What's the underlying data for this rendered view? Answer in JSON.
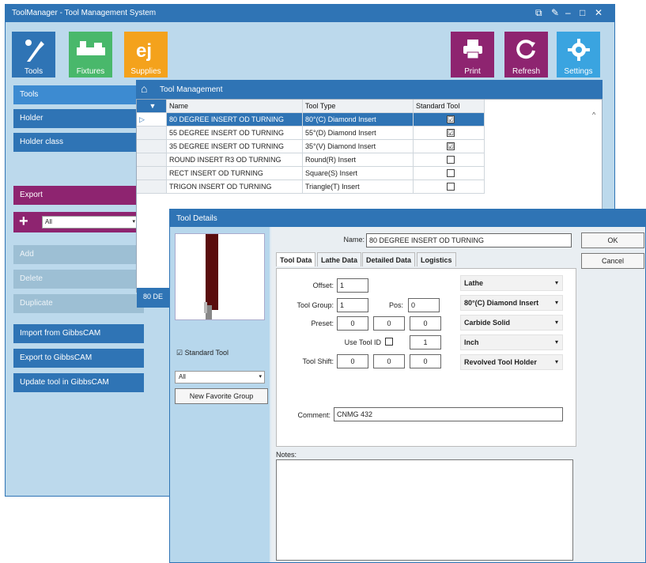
{
  "main_window": {
    "title": "ToolManager - Tool Management System",
    "ribbon_left": [
      {
        "label": "Tools",
        "icon": "tools-icon",
        "color": "#2f74b5"
      },
      {
        "label": "Fixtures",
        "icon": "fixtures-icon",
        "color": "#49b86b"
      },
      {
        "label": "Supplies",
        "icon": "supplies-icon",
        "color": "#f4a21c"
      }
    ],
    "ribbon_right": [
      {
        "label": "Print",
        "icon": "printer-icon",
        "color": "#8e2470"
      },
      {
        "label": "Refresh",
        "icon": "refresh-icon",
        "color": "#8e2470"
      },
      {
        "label": "Settings",
        "icon": "gear-icon",
        "color": "#3aa4e0"
      }
    ]
  },
  "sidebar": {
    "tools": "Tools",
    "holder": "Holder",
    "holder_class": "Holder class",
    "export": "Export",
    "filter_value": "All",
    "add": "Add",
    "delete": "Delete",
    "duplicate": "Duplicate",
    "import_gibbscam": "Import from GibbsCAM",
    "export_gibbscam": "Export to GibbsCAM",
    "update_gibbscam": "Update tool in GibbsCAM"
  },
  "grid": {
    "header_title": "Tool Management",
    "columns": [
      "Name",
      "Tool Type",
      "Standard Tool"
    ],
    "rows": [
      {
        "name": "80 DEGREE INSERT OD TURNING",
        "type": "80°(C) Diamond Insert",
        "checked": "☑"
      },
      {
        "name": "55 DEGREE INSERT OD TURNING",
        "type": "55°(D) Diamond Insert",
        "checked": "☑"
      },
      {
        "name": "35 DEGREE INSERT OD TURNING",
        "type": "35°(V) Diamond Insert",
        "checked": "☑"
      },
      {
        "name": "ROUND INSERT R3 OD TURNING",
        "type": "Round(R) Insert",
        "checked": ""
      },
      {
        "name": "RECT INSERT OD TURNING",
        "type": "Square(S) Insert",
        "checked": ""
      },
      {
        "name": "TRIGON INSERT OD TURNING",
        "type": "Triangle(T) Insert",
        "checked": ""
      }
    ],
    "footer_partial": "80 DE"
  },
  "dialog": {
    "title": "Tool Details",
    "name_label": "Name:",
    "name_value": "80 DEGREE INSERT OD TURNING",
    "ok": "OK",
    "cancel": "Cancel",
    "tabs": [
      "Tool Data",
      "Lathe Data",
      "Detailed Data",
      "Logistics"
    ],
    "standard_tool_label": "Standard Tool",
    "group_filter": "All",
    "new_favorite_group": "New Favorite Group",
    "offset_label": "Offset:",
    "offset_value": "1",
    "tool_group_label": "Tool Group:",
    "tool_group_value": "1",
    "pos_label": "Pos:",
    "pos_value": "0",
    "preset_label": "Preset:",
    "preset_values": [
      "0",
      "0",
      "0"
    ],
    "use_tool_id_label": "Use Tool ID",
    "use_tool_id_value": "1",
    "tool_shift_label": "Tool Shift:",
    "tool_shift_values": [
      "0",
      "0",
      "0"
    ],
    "combos": [
      "Lathe",
      "80°(C) Diamond Insert",
      "Carbide Solid",
      "Inch",
      "Revolved Tool Holder"
    ],
    "comment_label": "Comment:",
    "comment_value": "CNMG 432",
    "notes_label": "Notes:"
  }
}
